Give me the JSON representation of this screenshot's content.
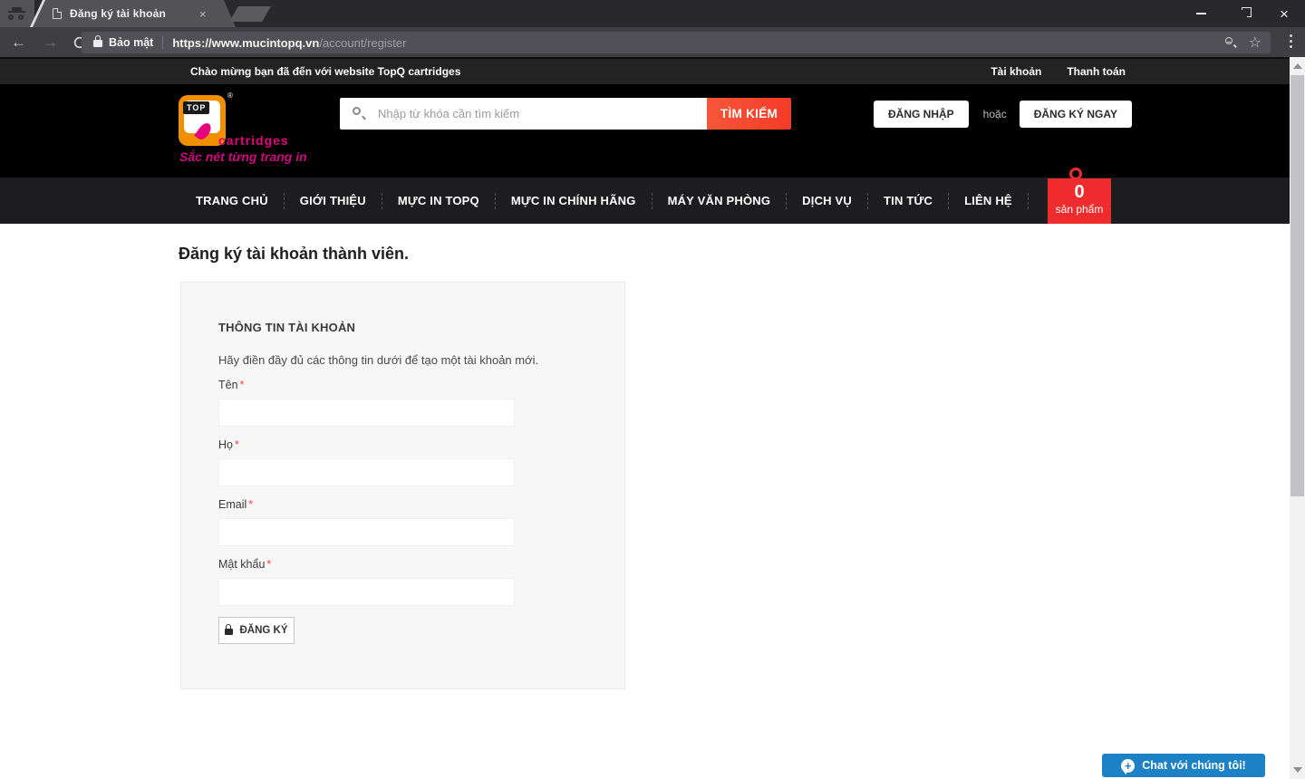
{
  "browser": {
    "tab_title": "Đăng ký tài khoản",
    "close_tab": "×",
    "security_label": "Bảo mật",
    "url_main": "https://www.mucintopq.vn",
    "url_path": "/account/register",
    "star_icon": "☆",
    "window_close": "×"
  },
  "topbar": {
    "welcome": "Chào mừng bạn đã đến với website TopQ cartridges",
    "links": [
      {
        "label": "Tài khoản"
      },
      {
        "label": "Thanh toán"
      }
    ]
  },
  "header": {
    "logo": {
      "top": "TOP",
      "registered": "®",
      "cartridges": "cartridges",
      "tagline": "Sắc nét từng trang in"
    },
    "search": {
      "placeholder": "Nhập từ khóa cần tìm kiếm",
      "button": "TÌM KIẾM"
    },
    "auth": {
      "login": "ĐĂNG NHẬP",
      "or": "hoặc",
      "register": "ĐĂNG KÝ NGAY"
    }
  },
  "nav": {
    "items": [
      "TRANG CHỦ",
      "GIỚI THIỆU",
      "MỰC IN TOPQ",
      "MỰC IN CHÍNH HÃNG",
      "MÁY VĂN PHÒNG",
      "DỊCH VỤ",
      "TIN TỨC",
      "LIÊN HỆ"
    ],
    "cart": {
      "count": "0",
      "label": "sản phẩm"
    }
  },
  "main": {
    "page_title": "Đăng ký tài khoản thành viên.",
    "form": {
      "section_title": "THÔNG TIN TÀI KHOẢN",
      "description": "Hãy điền đầy đủ các thông tin dưới để tạo một tài khoản mới.",
      "fields": [
        {
          "label": "Tên",
          "required": "*",
          "value": ""
        },
        {
          "label": "Họ",
          "required": "*",
          "value": ""
        },
        {
          "label": "Email",
          "required": "*",
          "value": ""
        },
        {
          "label": "Mật khẩu",
          "required": "*",
          "value": ""
        }
      ],
      "submit": "ĐĂNG KÝ"
    }
  },
  "chat": {
    "label": "Chat với chúng tôi!"
  },
  "colors": {
    "accent_red": "#f4432f",
    "cart_red": "#ee2c2e",
    "chat_blue": "#1c82c5",
    "logo_orange": "#f08f00",
    "logo_pink": "#e6007e"
  }
}
